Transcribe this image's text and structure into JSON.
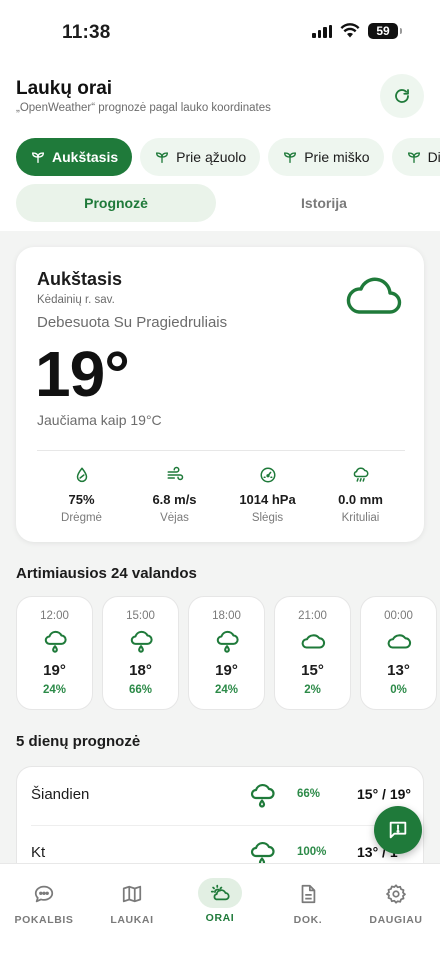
{
  "status": {
    "time": "11:38",
    "battery": "59"
  },
  "header": {
    "title": "Laukų orai",
    "subtitle": "„OpenWeather“ prognozė pagal lauko koordinates",
    "refresh_icon": "refresh-icon"
  },
  "fields": [
    {
      "label": "Aukštasis",
      "active": true
    },
    {
      "label": "Prie ąžuolo",
      "active": false
    },
    {
      "label": "Prie miško",
      "active": false
    },
    {
      "label": "Didys",
      "active": false
    }
  ],
  "tabs": [
    {
      "label": "Prognozė",
      "active": true
    },
    {
      "label": "Istorija",
      "active": false
    }
  ],
  "current": {
    "location": "Aukštasis",
    "region": "Kėdainių r. sav.",
    "condition": "Debesuota Su Pragiedruliais",
    "temperature": "19°",
    "feels_like": "Jaučiama kaip 19°C",
    "metrics": [
      {
        "icon": "humidity-icon",
        "value": "75%",
        "label": "Drėgmė"
      },
      {
        "icon": "wind-icon",
        "value": "6.8 m/s",
        "label": "Vėjas"
      },
      {
        "icon": "gauge-icon",
        "value": "1014 hPa",
        "label": "Slėgis"
      },
      {
        "icon": "rain-icon",
        "value": "0.0 mm",
        "label": "Krituliai"
      }
    ]
  },
  "hourly": {
    "title": "Artimiausios 24 valandos",
    "items": [
      {
        "time": "12:00",
        "icon": "rain-cloud-icon",
        "temp": "19°",
        "precip": "24%"
      },
      {
        "time": "15:00",
        "icon": "rain-cloud-icon",
        "temp": "18°",
        "precip": "66%"
      },
      {
        "time": "18:00",
        "icon": "rain-cloud-icon",
        "temp": "19°",
        "precip": "24%"
      },
      {
        "time": "21:00",
        "icon": "cloud-icon",
        "temp": "15°",
        "precip": "2%"
      },
      {
        "time": "00:00",
        "icon": "cloud-icon",
        "temp": "13°",
        "precip": "0%"
      }
    ]
  },
  "daily": {
    "title": "5 dienų prognozė",
    "items": [
      {
        "day": "Šiandien",
        "icon": "rain-cloud-icon",
        "precip": "66%",
        "range": "15° / 19°"
      },
      {
        "day": "Kt",
        "icon": "rain-cloud-icon",
        "precip": "100%",
        "range": "13° / 1"
      }
    ]
  },
  "fab_icon": "feedback-icon",
  "nav": [
    {
      "label": "POKALBIS",
      "icon": "chat-icon",
      "active": false
    },
    {
      "label": "LAUKAI",
      "icon": "map-icon",
      "active": false
    },
    {
      "label": "ORAI",
      "icon": "weather-icon",
      "active": true
    },
    {
      "label": "DOK.",
      "icon": "document-icon",
      "active": false
    },
    {
      "label": "DAUGIAU",
      "icon": "settings-icon",
      "active": false
    }
  ],
  "colors": {
    "accent": "#1f7a3a",
    "accent_light": "#eef6ef",
    "precip": "#2c8a48"
  }
}
